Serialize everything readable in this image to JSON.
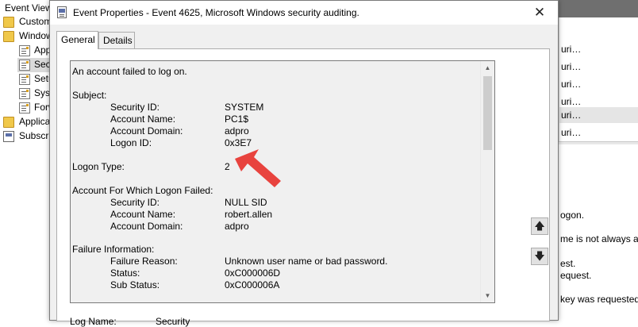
{
  "background": {
    "tree": {
      "header": "Event Viewer",
      "items": [
        {
          "label": "Custom Views",
          "icon": "folder-icon"
        },
        {
          "label": "Windows Logs",
          "icon": "folder-icon"
        },
        {
          "label": "Application",
          "icon": "log-icon"
        },
        {
          "label": "Security",
          "icon": "log-icon"
        },
        {
          "label": "Setup",
          "icon": "log-icon"
        },
        {
          "label": "System",
          "icon": "log-icon"
        },
        {
          "label": "Forwarded Events",
          "icon": "log-icon"
        },
        {
          "label": "Applications and Services Logs",
          "icon": "folder-icon"
        },
        {
          "label": "Subscriptions",
          "icon": "event-icon"
        }
      ]
    },
    "list_rows": [
      "uri…",
      "uri…",
      "uri…",
      "uri…",
      "uri…",
      "uri…"
    ],
    "detail_lines": [
      "ogon.",
      "me is not always av",
      "est.",
      "equest.",
      "key was requested"
    ]
  },
  "dialog": {
    "title": "Event Properties - Event 4625, Microsoft Windows security auditing.",
    "close_glyph": "✕",
    "tabs": [
      "General",
      "Details"
    ],
    "active_tab": "General",
    "event_text": {
      "summary": "An account failed to log on.",
      "subject": {
        "heading": "Subject:",
        "fields": [
          {
            "label": "Security ID:",
            "value": "SYSTEM"
          },
          {
            "label": "Account Name:",
            "value": "PC1$"
          },
          {
            "label": "Account Domain:",
            "value": "adpro"
          },
          {
            "label": "Logon ID:",
            "value": "0x3E7"
          }
        ]
      },
      "logon_type": {
        "label": "Logon Type:",
        "value": "2"
      },
      "account_failed": {
        "heading": "Account For Which Logon Failed:",
        "fields": [
          {
            "label": "Security ID:",
            "value": "NULL SID"
          },
          {
            "label": "Account Name:",
            "value": "robert.allen"
          },
          {
            "label": "Account Domain:",
            "value": "adpro"
          }
        ]
      },
      "failure": {
        "heading": "Failure Information:",
        "fields": [
          {
            "label": "Failure Reason:",
            "value": "Unknown user name or bad password."
          },
          {
            "label": "Status:",
            "value": "0xC000006D"
          },
          {
            "label": "Sub Status:",
            "value": "0xC000006A"
          }
        ]
      }
    },
    "nav": {
      "up_glyph": "🡅",
      "down_glyph": "🡇"
    },
    "partial_bottom": {
      "label": "Log Name:",
      "value": "Security"
    },
    "annotation_color": "#e8433e"
  }
}
